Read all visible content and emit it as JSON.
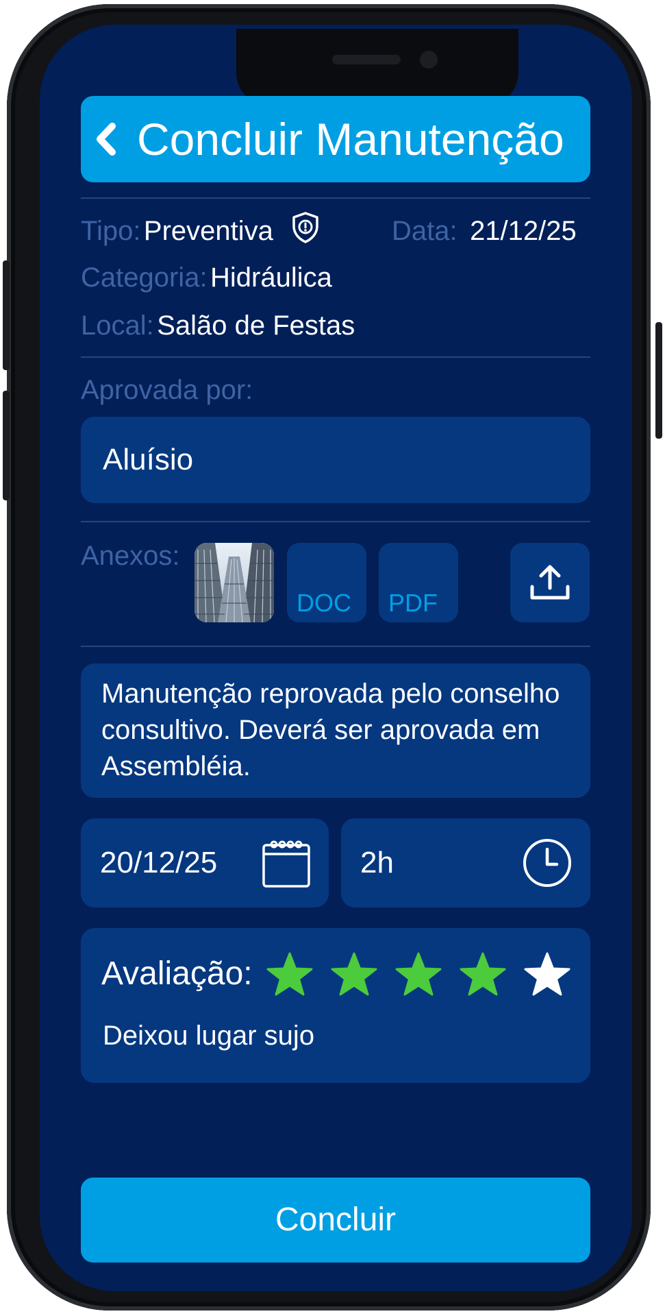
{
  "header": {
    "title": "Concluir Manutenção"
  },
  "info": {
    "tipo_label": "Tipo:",
    "tipo_value": "Preventiva",
    "data_label": "Data:",
    "data_value": "21/12/25",
    "categoria_label": "Categoria:",
    "categoria_value": "Hidráulica",
    "local_label": "Local:",
    "local_value": "Salão de Festas"
  },
  "approval": {
    "label": "Aprovada por:",
    "value": "Aluísio"
  },
  "attachments": {
    "label": "Anexos:",
    "items": [
      {
        "type": "image"
      },
      {
        "type": "doc",
        "label": "DOC"
      },
      {
        "type": "pdf",
        "label": "PDF"
      }
    ],
    "upload_icon": "upload-icon"
  },
  "note": {
    "text": "Manutenção reprovada pelo conselho consultivo. Deverá ser aprovada em Assembléia."
  },
  "schedule": {
    "date": "20/12/25",
    "duration": "2h",
    "date_icon": "calendar-icon",
    "duration_icon": "clock-icon"
  },
  "rating": {
    "label": "Avaliação:",
    "value": 4,
    "max": 5,
    "comment": "Deixou lugar sujo",
    "filled_color": "#4ccb3c",
    "empty_color": "#ffffff"
  },
  "actions": {
    "submit_label": "Concluir"
  },
  "colors": {
    "accent": "#009fe3",
    "background": "#021f57",
    "card": "#063880",
    "label": "#3f63a3"
  }
}
